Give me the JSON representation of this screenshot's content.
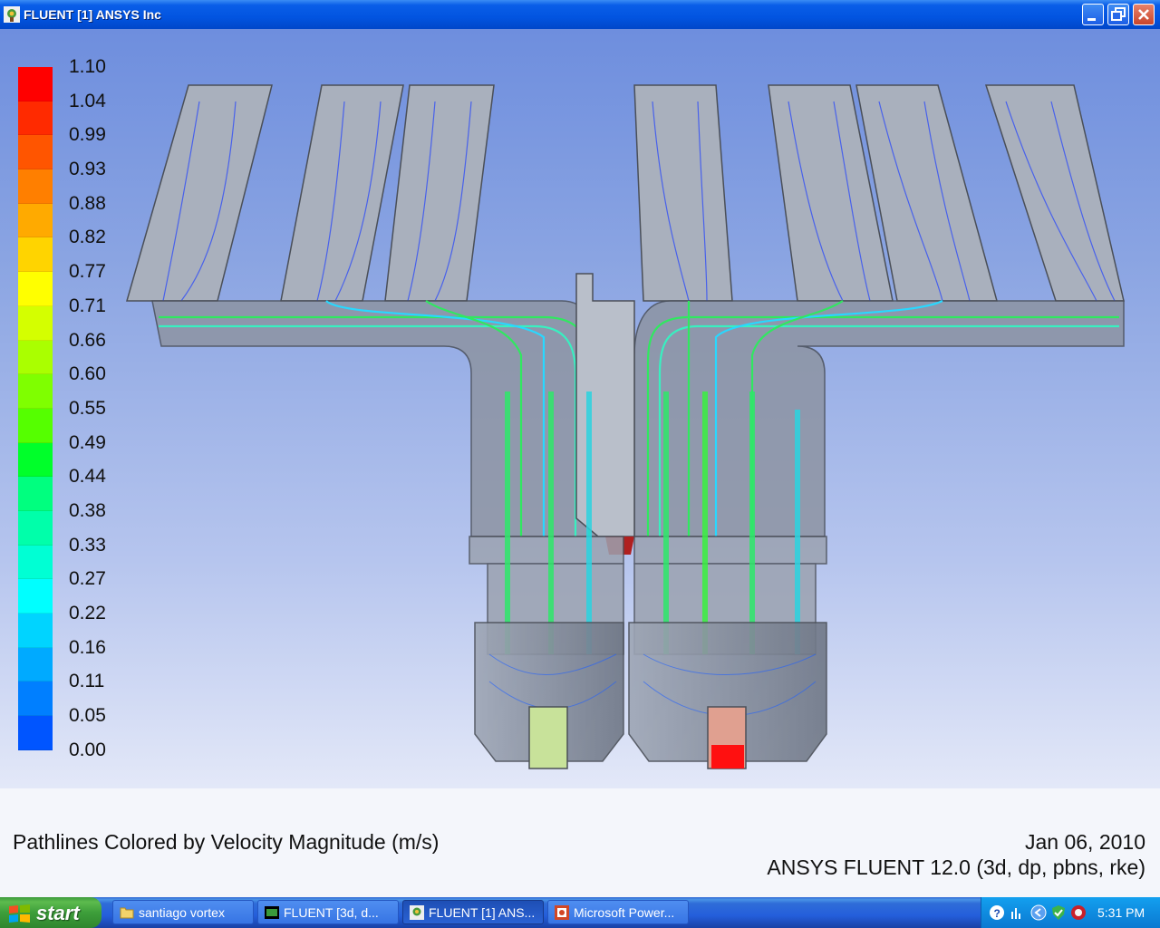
{
  "window": {
    "title": "FLUENT [1] ANSYS Inc",
    "minimize_icon": "minimize-icon",
    "maximize_icon": "restore-icon",
    "close_icon": "close-icon"
  },
  "legend": {
    "labels": [
      "1.10",
      "1.04",
      "0.99",
      "0.93",
      "0.88",
      "0.82",
      "0.77",
      "0.71",
      "0.66",
      "0.60",
      "0.55",
      "0.49",
      "0.44",
      "0.38",
      "0.33",
      "0.27",
      "0.22",
      "0.16",
      "0.11",
      "0.05",
      "0.00"
    ],
    "colors": [
      "#ff0000",
      "#ff2a00",
      "#ff5500",
      "#ff7f00",
      "#ffaa00",
      "#ffd400",
      "#ffff00",
      "#d4ff00",
      "#aaff00",
      "#7fff00",
      "#55ff00",
      "#00ff2a",
      "#00ff7f",
      "#00ffaa",
      "#00ffd4",
      "#00ffff",
      "#00d4ff",
      "#00aaff",
      "#007fff",
      "#0055ff",
      "#0000ff"
    ]
  },
  "caption": {
    "title": "Pathlines Colored by Velocity Magnitude (m/s)",
    "date": "Jan 06, 2010",
    "version": "ANSYS FLUENT 12.0 (3d, dp, pbns, rke)"
  },
  "taskbar": {
    "start_label": "start",
    "tasks": [
      {
        "label": "santiago vortex",
        "icon": "folder-icon"
      },
      {
        "label": "FLUENT  [3d, d...",
        "icon": "fluent-console-icon"
      },
      {
        "label": "FLUENT [1] ANS...",
        "icon": "fluent-icon"
      },
      {
        "label": "Microsoft Power...",
        "icon": "powerpoint-icon"
      }
    ],
    "clock": "5:31 PM"
  }
}
